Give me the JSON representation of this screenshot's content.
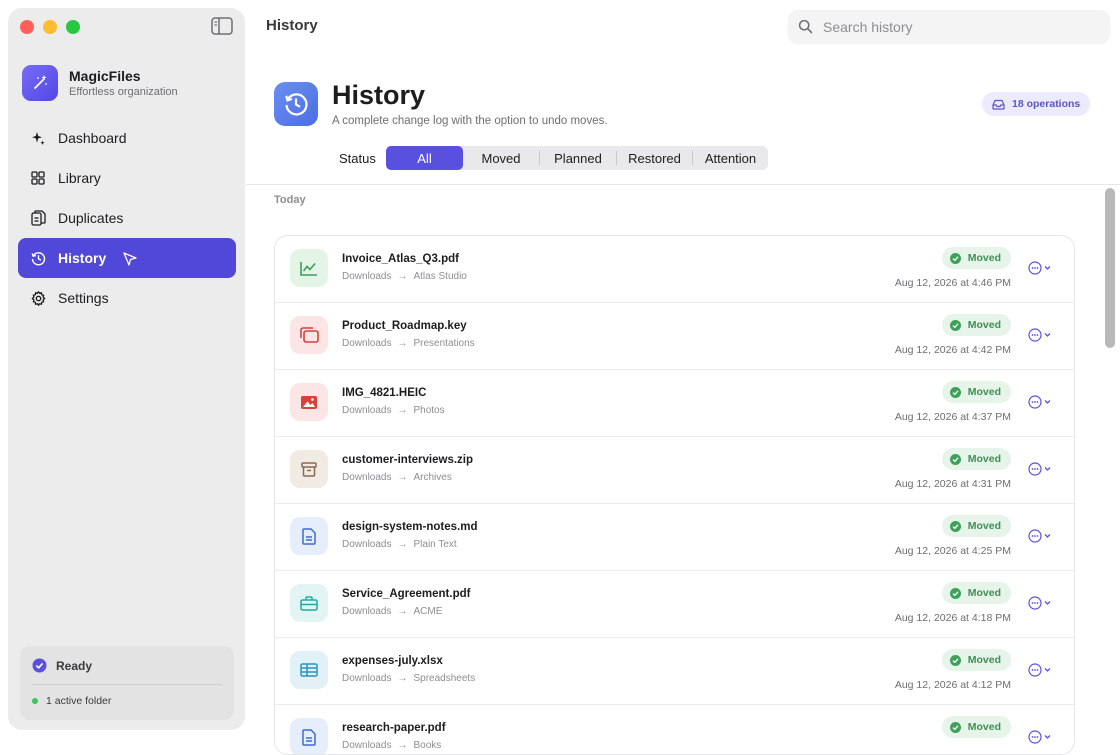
{
  "sidebar": {
    "brand": {
      "name": "MagicFiles",
      "subtitle": "Effortless organization"
    },
    "items": [
      {
        "label": "Dashboard",
        "icon": "sparkle-icon",
        "active": false
      },
      {
        "label": "Library",
        "icon": "grid-icon",
        "active": false
      },
      {
        "label": "Duplicates",
        "icon": "duplicate-icon",
        "active": false
      },
      {
        "label": "History",
        "icon": "history-icon",
        "active": true
      },
      {
        "label": "Settings",
        "icon": "gear-icon",
        "active": false
      }
    ],
    "status": {
      "label": "Ready",
      "folders": "1 active folder"
    }
  },
  "topbar": {
    "title": "History",
    "search_placeholder": "Search history"
  },
  "header": {
    "title": "History",
    "subtitle": "A complete change log with the option to undo moves.",
    "ops_badge": "18 operations"
  },
  "filters": {
    "label": "Status",
    "options": [
      "All",
      "Moved",
      "Planned",
      "Restored",
      "Attention"
    ],
    "selected": "All"
  },
  "section_label": "Today",
  "rows": [
    {
      "name": "Invoice_Atlas_Q3.pdf",
      "from": "Downloads",
      "to": "Atlas Studio",
      "status": "Moved",
      "time": "Aug 12, 2026 at 4:46 PM",
      "icon": "chart-icon"
    },
    {
      "name": "Product_Roadmap.key",
      "from": "Downloads",
      "to": "Presentations",
      "status": "Moved",
      "time": "Aug 12, 2026 at 4:42 PM",
      "icon": "slides-icon"
    },
    {
      "name": "IMG_4821.HEIC",
      "from": "Downloads",
      "to": "Photos",
      "status": "Moved",
      "time": "Aug 12, 2026 at 4:37 PM",
      "icon": "photo-icon"
    },
    {
      "name": "customer-interviews.zip",
      "from": "Downloads",
      "to": "Archives",
      "status": "Moved",
      "time": "Aug 12, 2026 at 4:31 PM",
      "icon": "archive-icon"
    },
    {
      "name": "design-system-notes.md",
      "from": "Downloads",
      "to": "Plain Text",
      "status": "Moved",
      "time": "Aug 12, 2026 at 4:25 PM",
      "icon": "document-icon"
    },
    {
      "name": "Service_Agreement.pdf",
      "from": "Downloads",
      "to": "ACME",
      "status": "Moved",
      "time": "Aug 12, 2026 at 4:18 PM",
      "icon": "briefcase-icon"
    },
    {
      "name": "expenses-july.xlsx",
      "from": "Downloads",
      "to": "Spreadsheets",
      "status": "Moved",
      "time": "Aug 12, 2026 at 4:12 PM",
      "icon": "table-icon"
    },
    {
      "name": "research-paper.pdf",
      "from": "Downloads",
      "to": "Books",
      "status": "Moved",
      "time": "",
      "icon": "document-icon"
    }
  ]
}
